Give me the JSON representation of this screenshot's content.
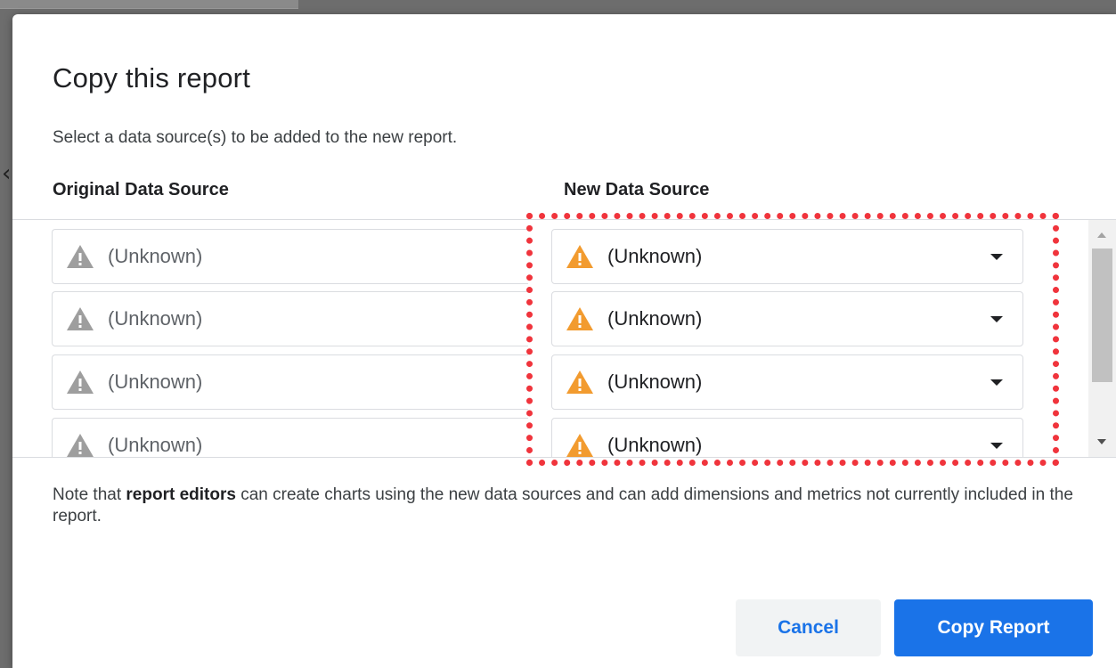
{
  "dialog": {
    "title": "Copy this report",
    "subtitle": "Select a data source(s) to be added to the new report.",
    "columns": {
      "original": "Original Data Source",
      "new": "New Data Source"
    },
    "rows": [
      {
        "original": "(Unknown)",
        "new": "(Unknown)"
      },
      {
        "original": "(Unknown)",
        "new": "(Unknown)"
      },
      {
        "original": "(Unknown)",
        "new": "(Unknown)"
      },
      {
        "original": "(Unknown)",
        "new": "(Unknown)"
      }
    ],
    "note": {
      "prefix": "Note that ",
      "bold": "report editors",
      "suffix": " can create charts using the new data sources and can add dimensions and metrics not currently included in the report."
    },
    "buttons": {
      "cancel": "Cancel",
      "copy": "Copy Report"
    }
  },
  "icons": {
    "original_warning": "warning-icon",
    "new_warning": "warning-icon",
    "dropdown": "chevron-down-icon"
  },
  "colors": {
    "accent": "#1a73e8",
    "warning_gray": "#9e9e9e",
    "warning_orange": "#f29b2f",
    "highlight": "#f0343c"
  }
}
